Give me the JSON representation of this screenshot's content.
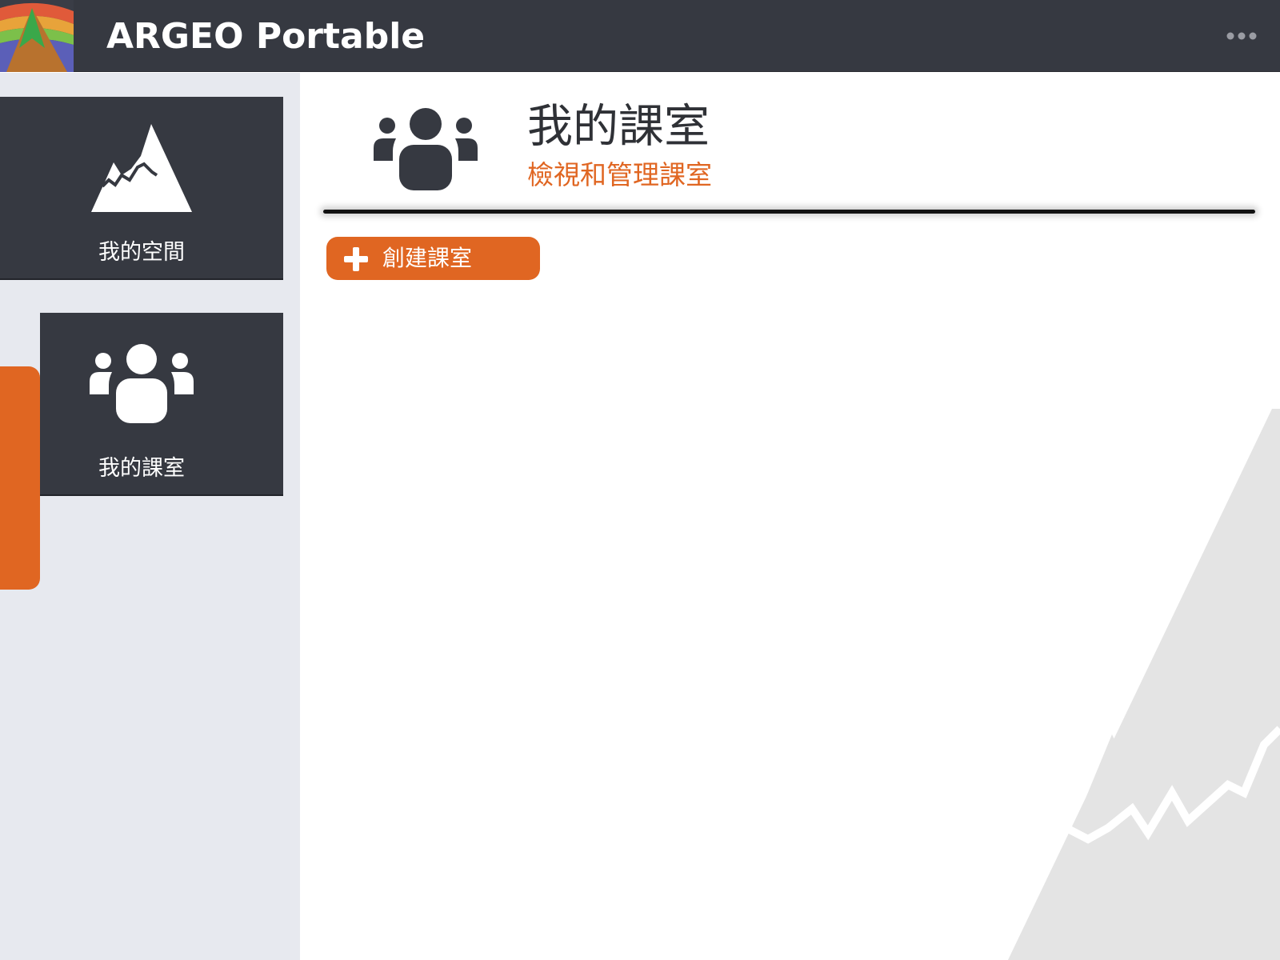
{
  "app": {
    "title": "ARGEO Portable",
    "menu_icon": "ellipsis-icon"
  },
  "sidebar": {
    "items": [
      {
        "label": "我的空間",
        "icon": "mountain-icon",
        "active": false
      },
      {
        "label": "我的課室",
        "icon": "group-icon",
        "active": true
      }
    ]
  },
  "main": {
    "header_icon": "group-icon",
    "title": "我的課室",
    "subtitle": "檢視和管理課室",
    "create_button": {
      "label": "創建課室",
      "icon": "plus-icon"
    }
  },
  "colors": {
    "topbar": "#363941",
    "sidebar_bg": "#e7e9ef",
    "card_bg": "#363941",
    "accent": "#e06622",
    "title_text": "#2f3136",
    "bg_mountain": "#e4e4e4"
  }
}
